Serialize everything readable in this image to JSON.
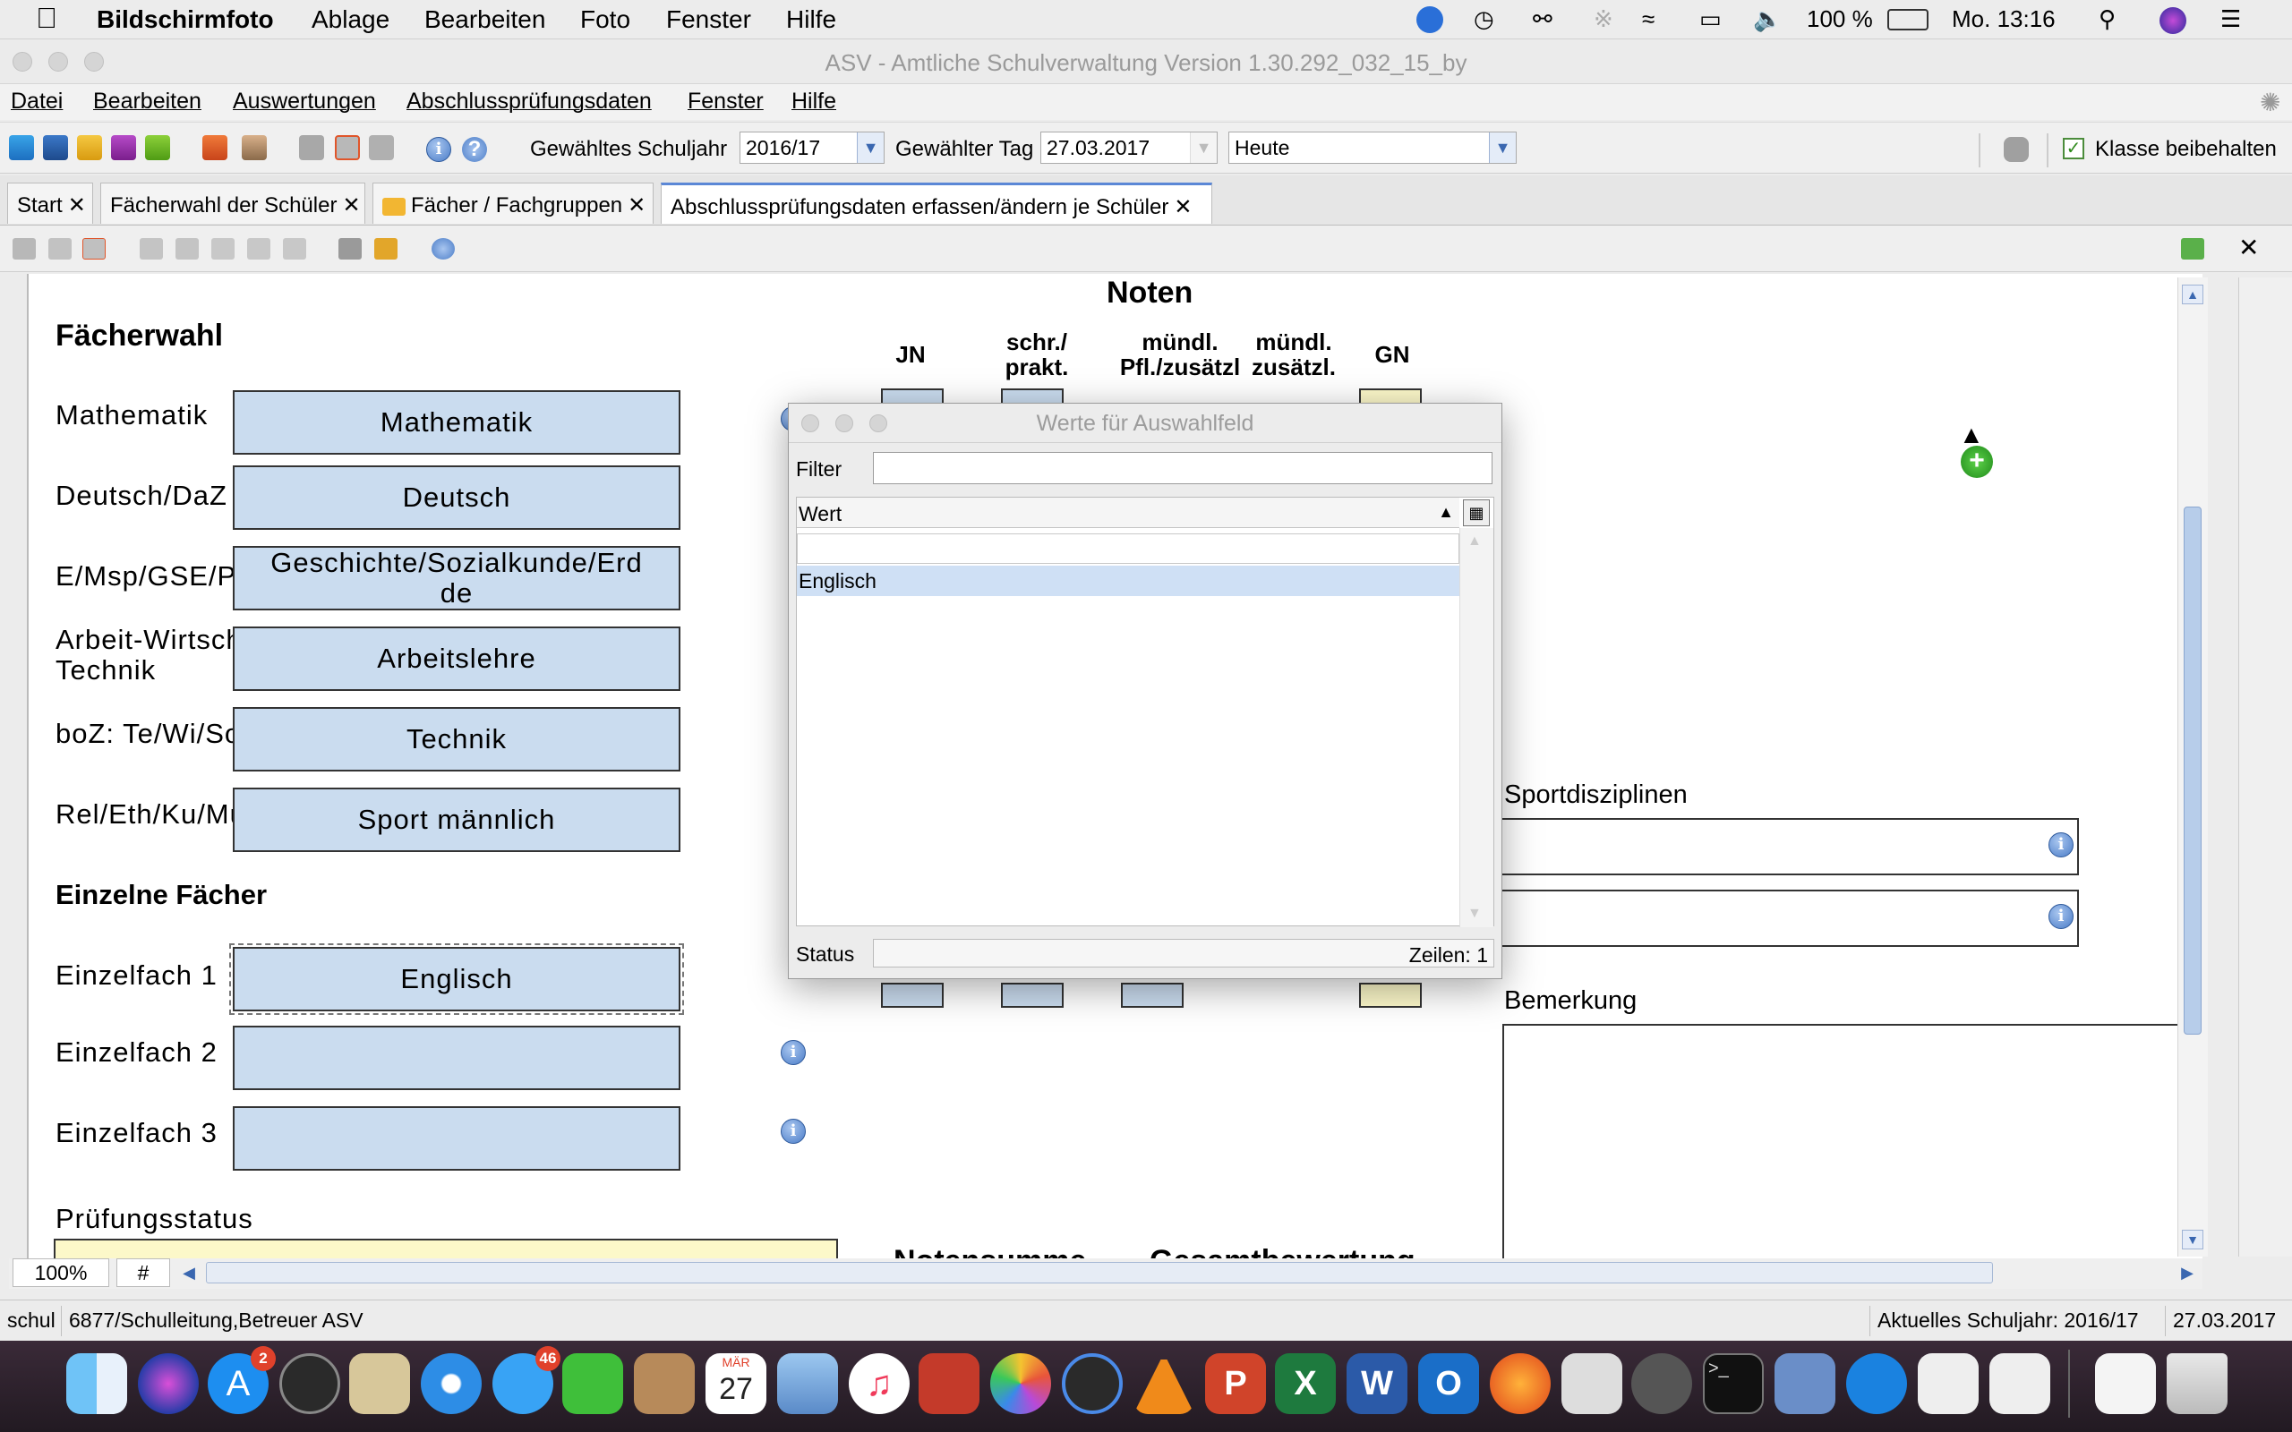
{
  "menubar": {
    "app_name": "Bildschirmfoto",
    "items": [
      "Ablage",
      "Bearbeiten",
      "Foto",
      "Fenster",
      "Hilfe"
    ],
    "battery": "100 %",
    "clock": "Mo. 13:16"
  },
  "window": {
    "title": "ASV - Amtliche Schulverwaltung Version 1.30.292_032_15_by"
  },
  "appmenu": [
    "Datei",
    "Bearbeiten",
    "Auswertungen",
    "Abschlussprüfungsdaten",
    "Fenster",
    "Hilfe"
  ],
  "toolbar": {
    "schuljahr_label": "Gewähltes Schuljahr",
    "schuljahr_value": "2016/17",
    "tag_label": "Gewählter Tag",
    "tag_value": "27.03.2017",
    "heute_value": "Heute",
    "klasse_label": "Klasse beibehalten"
  },
  "tabs": [
    {
      "label": "Start"
    },
    {
      "label": "Fächerwahl der Schüler"
    },
    {
      "label": "Fächer / Fachgruppen"
    },
    {
      "label": "Abschlussprüfungsdaten erfassen/ändern je Schüler"
    }
  ],
  "form": {
    "noten_header": "Noten",
    "col_jn": "JN",
    "col_schr_1": "schr./",
    "col_schr_2": "prakt.",
    "col_muendl_1": "mündl.",
    "col_muendl_2": "Pfl./zusätzl",
    "col_muendl_zus_1": "mündl.",
    "col_muendl_zus_2": "zusätzl.",
    "col_gn": "GN",
    "faecherwahl_header": "Fächerwahl",
    "einzelne_header": "Einzelne Fächer",
    "rows": [
      {
        "label": "Mathematik",
        "value": "Mathematik"
      },
      {
        "label": "Deutsch/DaZ",
        "value": "Deutsch"
      },
      {
        "label": "E/Msp/GSE/PCB",
        "value": "Geschichte/Sozialkunde/Erd\nde"
      },
      {
        "label": "Arbeit-Wirtschaft-\nTechnik",
        "value": "Arbeitslehre"
      },
      {
        "label": "boZ: Te/Wi/So",
        "value": "Technik"
      },
      {
        "label": "Rel/Eth/Ku/Mu/S",
        "value": "Sport männlich"
      }
    ],
    "einzel": [
      {
        "label": "Einzelfach 1",
        "value": "Englisch"
      },
      {
        "label": "Einzelfach 2",
        "value": ""
      },
      {
        "label": "Einzelfach 3",
        "value": ""
      }
    ],
    "pruefungsstatus_label": "Prüfungsstatus",
    "notensumme_label": "Notensumme",
    "gesamtbewertung_label": "Gesamtbewertung",
    "sportdisziplinen_label": "Sportdisziplinen",
    "bemerkung_label": "Bemerkung"
  },
  "dialog": {
    "title": "Werte für Auswahlfeld",
    "filter_label": "Filter",
    "filter_value": "",
    "column": "Wert",
    "rows": [
      "",
      "Englisch"
    ],
    "status_label": "Status",
    "status_value": "Zeilen: 1"
  },
  "zoom": {
    "value": "100%",
    "hash": "#"
  },
  "statusbar": {
    "user_short": "schul",
    "user": "6877/Schulleitung,Betreuer ASV",
    "schuljahr": "Aktuelles Schuljahr: 2016/17",
    "date": "27.03.2017"
  },
  "dock": {
    "calendar_month": "MÄR",
    "calendar_day": "27",
    "badge_appstore": "2",
    "badge_messages": "46"
  }
}
